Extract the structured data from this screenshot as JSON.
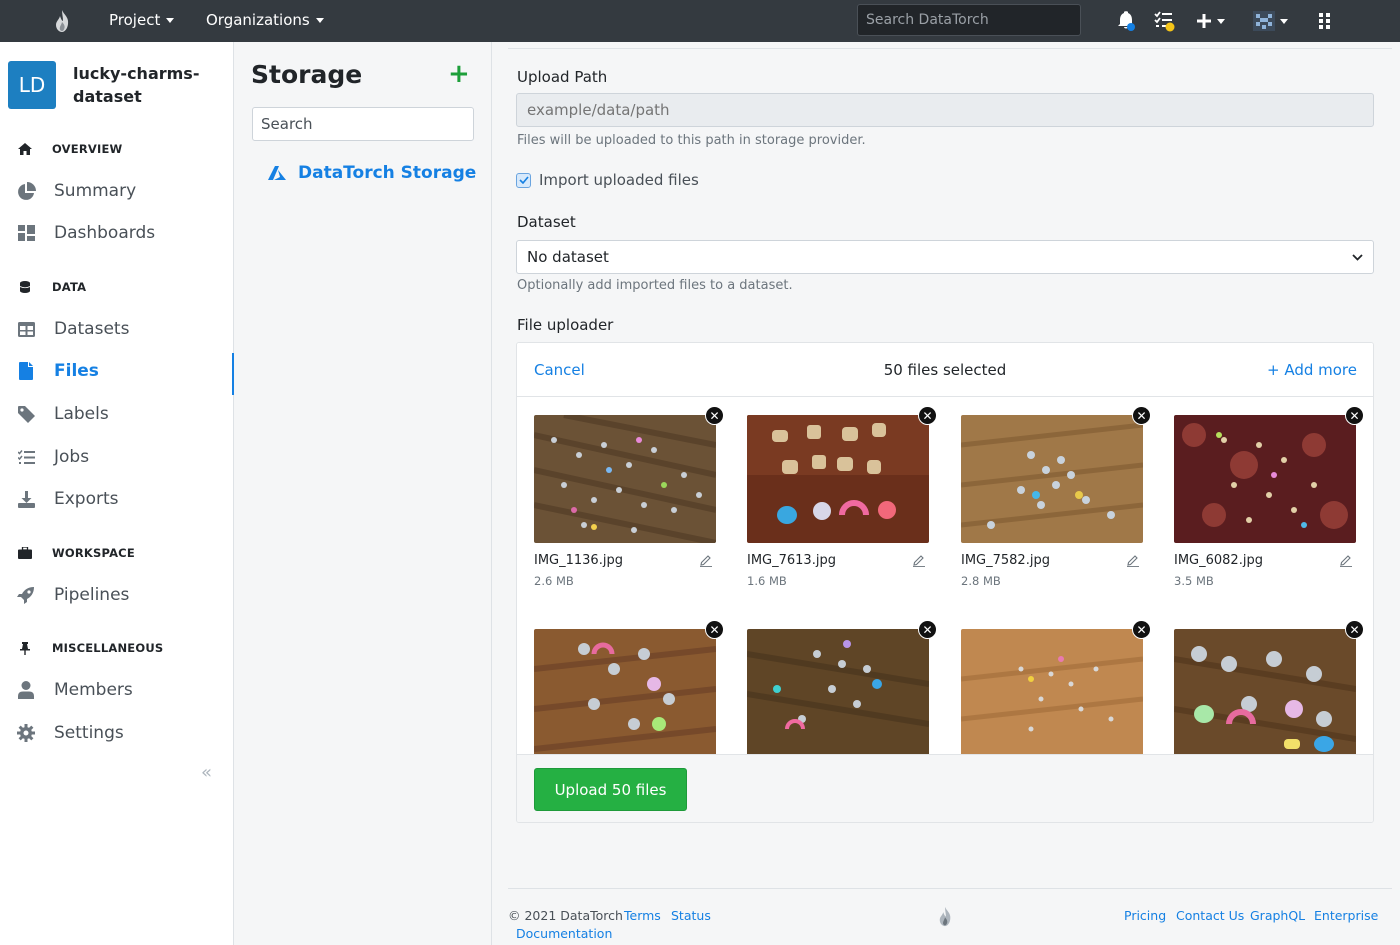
{
  "topbar": {
    "project_label": "Project",
    "organizations_label": "Organizations",
    "search_placeholder": "Search DataTorch"
  },
  "sidebar": {
    "avatar_initials": "LD",
    "project_name": "lucky-charms-dataset",
    "sections": {
      "overview": "OVERVIEW",
      "data": "DATA",
      "workspace": "WORKSPACE",
      "misc": "MISCELLANEOUS"
    },
    "items": {
      "summary": "Summary",
      "dashboards": "Dashboards",
      "datasets": "Datasets",
      "files": "Files",
      "labels": "Labels",
      "jobs": "Jobs",
      "exports": "Exports",
      "pipelines": "Pipelines",
      "members": "Members",
      "settings": "Settings"
    },
    "collapse_glyph": "«"
  },
  "storage": {
    "title": "Storage",
    "add_glyph": "+",
    "search_placeholder": "Search",
    "provider": "DataTorch Storage"
  },
  "form": {
    "upload_path_label": "Upload Path",
    "upload_path_placeholder": "example/data/path",
    "upload_path_help": "Files will be uploaded to this path in storage provider.",
    "import_label": "Import uploaded files",
    "dataset_label": "Dataset",
    "dataset_value": "No dataset",
    "dataset_help": "Optionally add imported files to a dataset.",
    "uploader_label": "File uploader"
  },
  "uploader": {
    "cancel": "Cancel",
    "count": "50 files selected",
    "add_more": "Add more",
    "upload_button": "Upload 50 files",
    "files": [
      {
        "name": "IMG_1136.jpg",
        "size": "2.6 MB"
      },
      {
        "name": "IMG_7613.jpg",
        "size": "1.6 MB"
      },
      {
        "name": "IMG_7582.jpg",
        "size": "2.8 MB"
      },
      {
        "name": "IMG_6082.jpg",
        "size": "3.5 MB"
      },
      {
        "name": "",
        "size": ""
      },
      {
        "name": "",
        "size": ""
      },
      {
        "name": "",
        "size": ""
      },
      {
        "name": "",
        "size": ""
      }
    ]
  },
  "footer": {
    "copyright": "© 2021 DataTorch",
    "terms": "Terms",
    "status": "Status",
    "documentation": "Documentation",
    "pricing": "Pricing",
    "contact": "Contact Us",
    "graphql": "GraphQL",
    "enterprise": "Enterprise"
  },
  "colors": {
    "accent": "#1580e3",
    "success": "#25b043",
    "navbar": "#343a40"
  }
}
